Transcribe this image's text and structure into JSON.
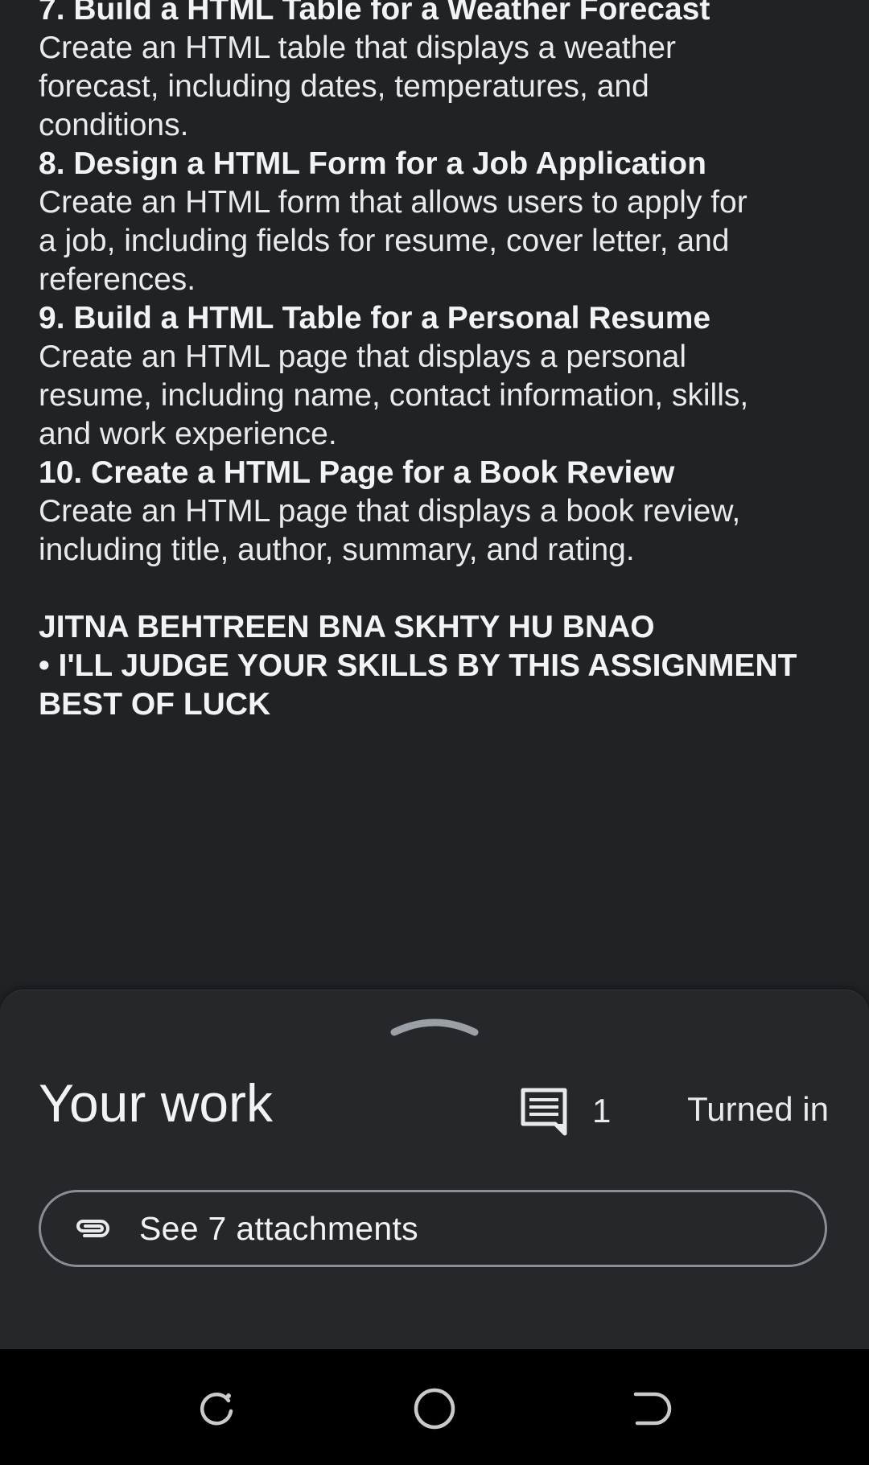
{
  "assignments": [
    {
      "title": "7. Build a HTML Table for a Weather Forecast",
      "desc_lines": [
        "Create an HTML table that displays a weather",
        "forecast, including dates, temperatures, and",
        "conditions."
      ]
    },
    {
      "title": "8. Design a HTML Form for a Job Application",
      "desc_lines": [
        "Create an HTML form that allows users to apply for",
        "a job, including fields for resume, cover letter, and",
        "references."
      ]
    },
    {
      "title": "9. Build a HTML Table for a Personal Resume",
      "desc_lines": [
        "Create an HTML page that displays a personal",
        "resume, including name, contact information, skills,",
        "and work experience."
      ]
    },
    {
      "title": "10. Create a HTML Page for a Book Review",
      "desc_lines": [
        "Create an HTML page that displays a book review,",
        "including title, author, summary, and rating."
      ]
    }
  ],
  "notes": [
    "JITNA BEHTREEN BNA SKHTY HU BNAO",
    "• I'LL JUDGE YOUR SKILLS BY THIS ASSIGNMENT",
    "BEST OF LUCK"
  ],
  "sheet": {
    "heading": "Your work",
    "comment_icon": "comment-icon",
    "comment_count": "1",
    "status": "Turned in",
    "attach_icon": "paperclip-icon",
    "attach_label": "See 7 attachments"
  },
  "navbar": {
    "icons": [
      "recent-apps-icon",
      "home-icon",
      "back-icon"
    ]
  },
  "colors": {
    "background": "#212226",
    "sheet": "#26272b",
    "text": "#e8eaed",
    "navbar": "#000000"
  }
}
